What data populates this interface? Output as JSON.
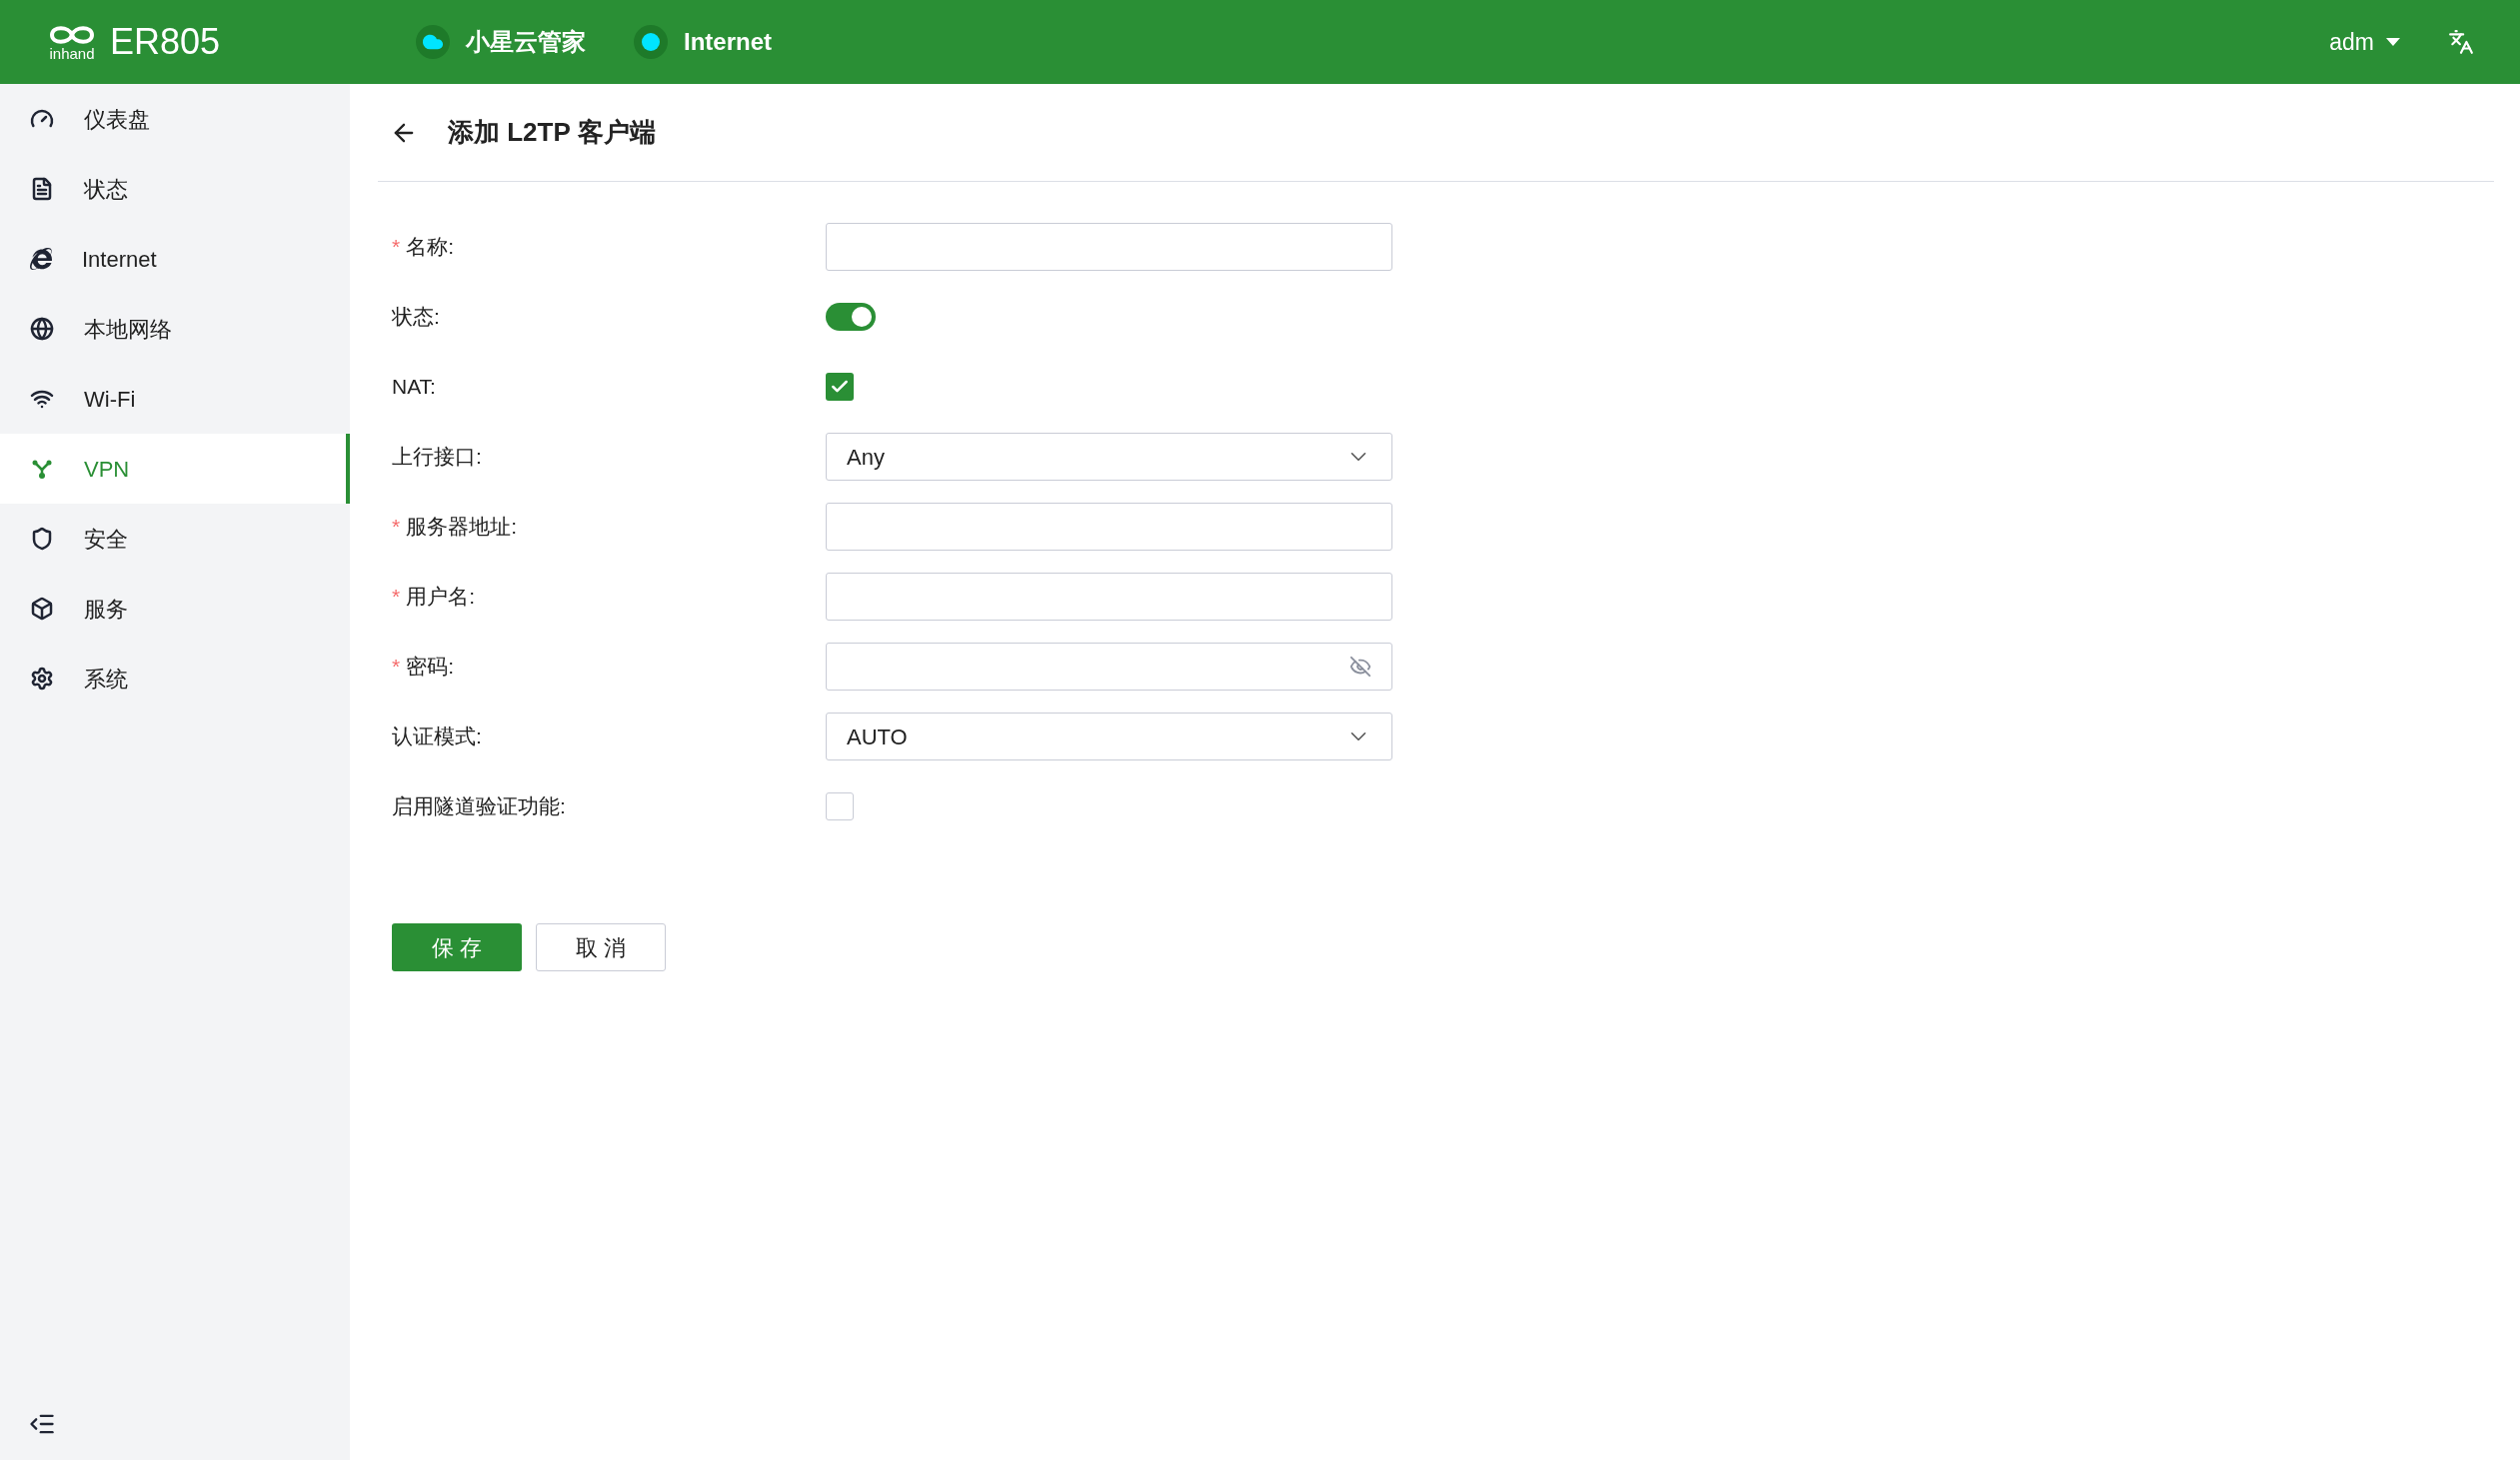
{
  "header": {
    "logo_text": "inhand",
    "product": "ER805",
    "status_items": [
      {
        "kind": "cloud",
        "label": "小星云管家"
      },
      {
        "kind": "dot",
        "label": "Internet"
      }
    ],
    "user": "adm"
  },
  "sidebar": {
    "items": [
      {
        "label": "仪表盘",
        "selected": false
      },
      {
        "label": "状态",
        "selected": false
      },
      {
        "label": "Internet",
        "selected": false
      },
      {
        "label": "本地网络",
        "selected": false
      },
      {
        "label": "Wi-Fi",
        "selected": false
      },
      {
        "label": "VPN",
        "selected": true
      },
      {
        "label": "安全",
        "selected": false
      },
      {
        "label": "服务",
        "selected": false
      },
      {
        "label": "系统",
        "selected": false
      }
    ]
  },
  "page": {
    "title": "添加 L2TP 客户端"
  },
  "form": {
    "fields": [
      {
        "kind": "text",
        "label": "名称:",
        "required_mark": "*"
      },
      {
        "kind": "switch",
        "label": "状态:",
        "on": true
      },
      {
        "kind": "checkbox",
        "label": "NAT:",
        "checked": true
      },
      {
        "kind": "select",
        "label": "上行接口:",
        "value": "Any"
      },
      {
        "kind": "text",
        "label": "服务器地址:",
        "required_mark": "*"
      },
      {
        "kind": "text",
        "label": "用户名:",
        "required_mark": "*"
      },
      {
        "kind": "password",
        "label": "密码:",
        "required_mark": "*"
      },
      {
        "kind": "select",
        "label": "认证模式:",
        "value": "AUTO"
      },
      {
        "kind": "checkbox",
        "label": "启用隧道验证功能:",
        "checked": false
      }
    ]
  },
  "buttons": [
    {
      "kind": "primary",
      "label": "保 存"
    },
    {
      "kind": "secondary",
      "label": "取 消"
    }
  ]
}
